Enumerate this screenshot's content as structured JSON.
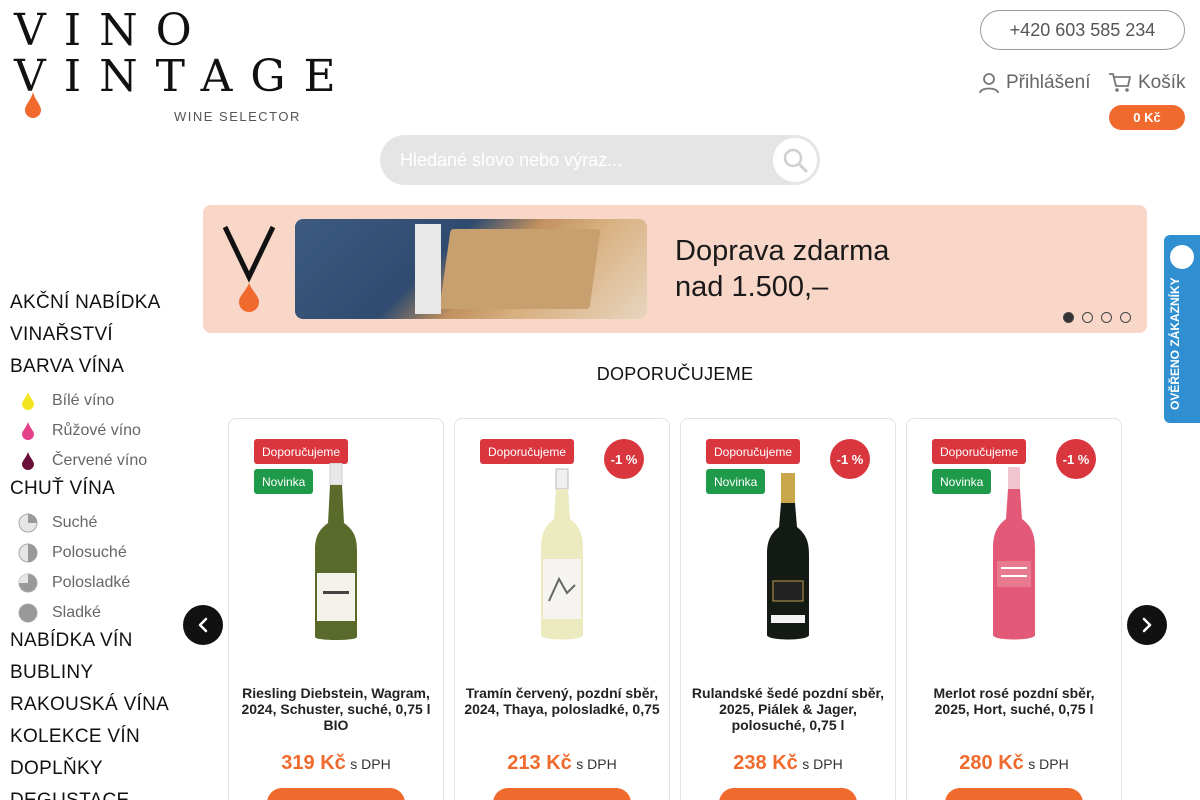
{
  "logo": {
    "line1": "VINO",
    "line2": "VINTAGE",
    "tagline": "WINE SELECTOR"
  },
  "header": {
    "phone": "+420 603 585 234",
    "login_label": "Přihlášení",
    "cart_label": "Košík",
    "cart_total": "0 Kč"
  },
  "search": {
    "placeholder": "Hledané slovo nebo výraz..."
  },
  "sidebar": {
    "akcni": "AKČNÍ NABÍDKA",
    "vinarstvi": "VINAŘSTVÍ",
    "barva": "BARVA VÍNA",
    "barva_items": [
      "Bílé víno",
      "Růžové víno",
      "Červené víno"
    ],
    "chut": "CHUŤ VÍNA",
    "chut_items": [
      "Suché",
      "Polosuché",
      "Polosladké",
      "Sladké"
    ],
    "nabidka": "NABÍDKA VÍN",
    "bubliny": "BUBLINY",
    "rakouska": "RAKOUSKÁ VÍNA",
    "kolekce": "KOLEKCE VÍN",
    "doplnky": "DOPLŇKY",
    "degustace": "DEGUSTACE"
  },
  "banner": {
    "line1": "Doprava zdarma",
    "line2": "nad 1.500,–",
    "slide_count": 4,
    "active_slide": 1
  },
  "verified_badge": {
    "text": "OVĚŘENO ZÁKAZNÍKY"
  },
  "section": {
    "title": "DOPORUČUJEME"
  },
  "products": [
    {
      "badge_rec": "Doporučujeme",
      "badge_new": "Novinka",
      "discount": "",
      "name": "Riesling Diebstein, Wagram, 2024, Schuster, suché, 0,75 l BIO",
      "price": "319 Kč",
      "vat": "s DPH"
    },
    {
      "badge_rec": "Doporučujeme",
      "badge_new": "",
      "discount": "-1 %",
      "name": "Tramín červený, pozdní sběr, 2024, Thaya, polosladké, 0,75",
      "price": "213 Kč",
      "vat": "s DPH"
    },
    {
      "badge_rec": "Doporučujeme",
      "badge_new": "Novinka",
      "discount": "-1 %",
      "name": "Rulandské šedé pozdní sběr, 2025, Piálek & Jager, polosuché, 0,75 l",
      "price": "238 Kč",
      "vat": "s DPH"
    },
    {
      "badge_rec": "Doporučujeme",
      "badge_new": "Novinka",
      "discount": "-1 %",
      "name": "Merlot rosé pozdní sběr, 2025, Hort, suché, 0,75 l",
      "price": "280 Kč",
      "vat": "s DPH"
    }
  ],
  "colors": {
    "accent": "#ef6a2c",
    "badge_red": "#d9363e",
    "badge_green": "#1e9a4a",
    "banner_bg": "#f8d6c8",
    "verified_blue": "#2f8fd0"
  }
}
